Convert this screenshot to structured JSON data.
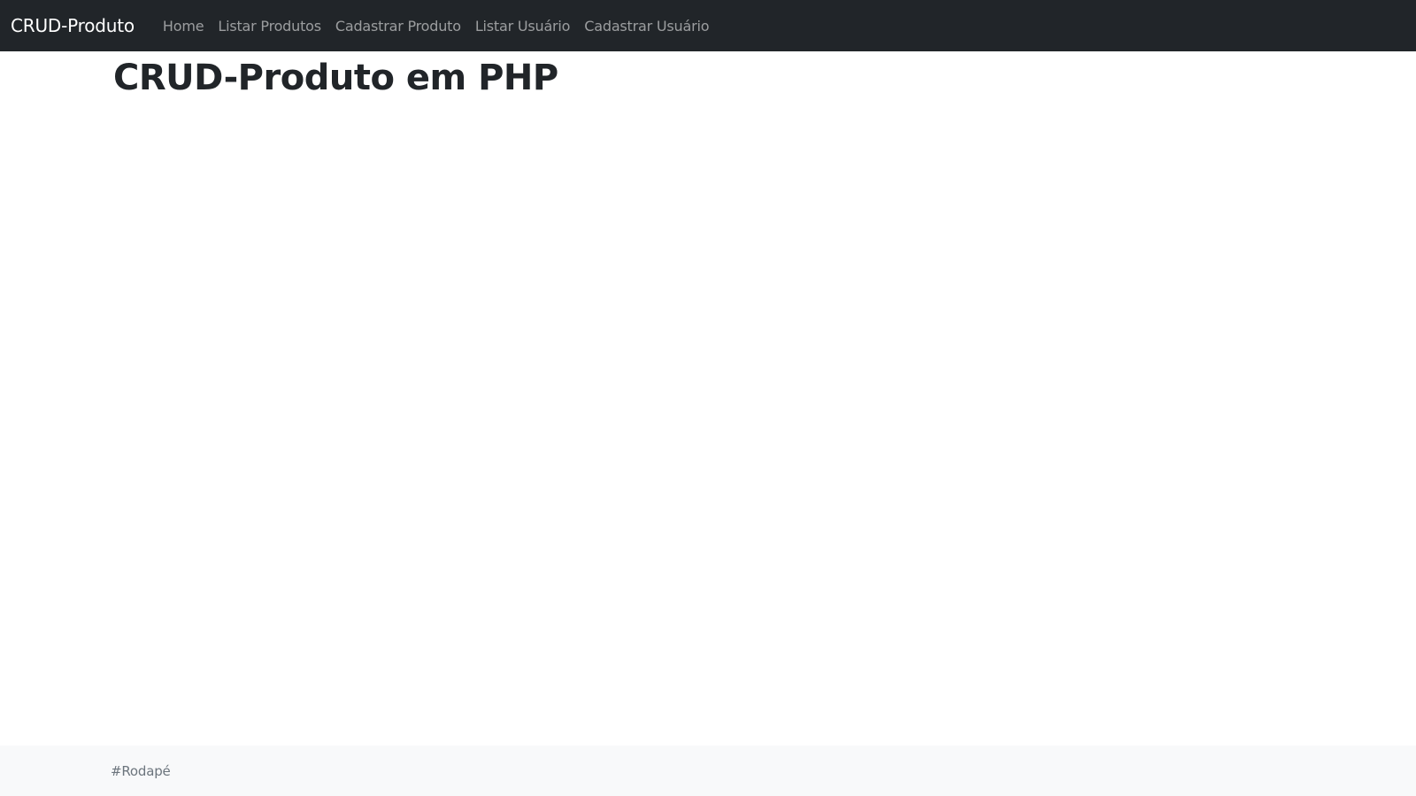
{
  "navbar": {
    "brand": "CRUD-Produto",
    "items": [
      {
        "label": "Home"
      },
      {
        "label": "Listar Produtos"
      },
      {
        "label": "Cadastrar Produto"
      },
      {
        "label": "Listar Usuário"
      },
      {
        "label": "Cadastrar Usuário"
      }
    ]
  },
  "main": {
    "title": "CRUD-Produto em PHP"
  },
  "footer": {
    "text": "#Rodapé"
  },
  "colors": {
    "navbar_bg": "#212529",
    "footer_bg": "#f8f9fa",
    "nav_link": "rgba(255,255,255,0.55)",
    "brand": "#ffffff"
  }
}
